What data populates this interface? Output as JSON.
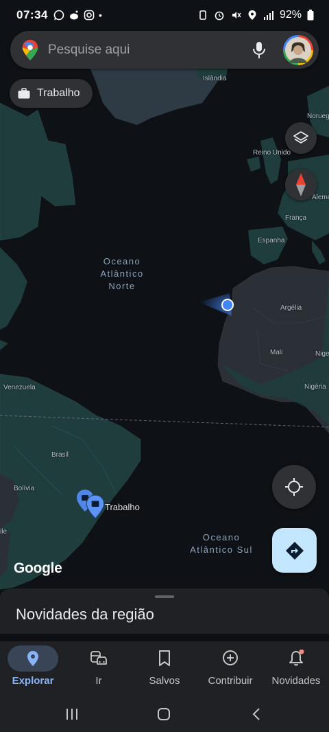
{
  "status_bar": {
    "time": "07:34",
    "battery": "92%"
  },
  "search": {
    "placeholder": "Pesquise aqui"
  },
  "chip": {
    "label": "Trabalho"
  },
  "map": {
    "labels": {
      "islandia": "Islândia",
      "noruega": "Noruega",
      "reino_unido": "Reino Unido",
      "alemanha": "Alema",
      "franca": "França",
      "espanha": "Espanha",
      "argelia": "Argélia",
      "mali": "Mali",
      "niger": "Nige",
      "nigeria": "Nigéria",
      "venezuela": "Venezuela",
      "brasil": "Brasil",
      "bolivia": "Bolívia",
      "chile": "ile",
      "marker_trabalho": "Trabalho"
    },
    "ocean_north": [
      "Oceano",
      "Atlântico",
      "Norte"
    ],
    "ocean_south": [
      "Oceano",
      "Atlântico Sul"
    ],
    "logo": "Google"
  },
  "sheet": {
    "title": "Novidades da região"
  },
  "nav": [
    {
      "label": "Explorar",
      "icon": "explore-pin-icon",
      "active": true
    },
    {
      "label": "Ir",
      "icon": "transport-icon",
      "active": false
    },
    {
      "label": "Salvos",
      "icon": "bookmark-icon",
      "active": false
    },
    {
      "label": "Contribuir",
      "icon": "add-circle-icon",
      "active": false
    },
    {
      "label": "Novidades",
      "icon": "bell-icon",
      "active": false
    }
  ],
  "colors": {
    "accent": "#8ab4f8",
    "land": "#1f3d3d",
    "ocean": "#0e1116",
    "pill": "#394457",
    "fab": "#c2e7ff"
  }
}
